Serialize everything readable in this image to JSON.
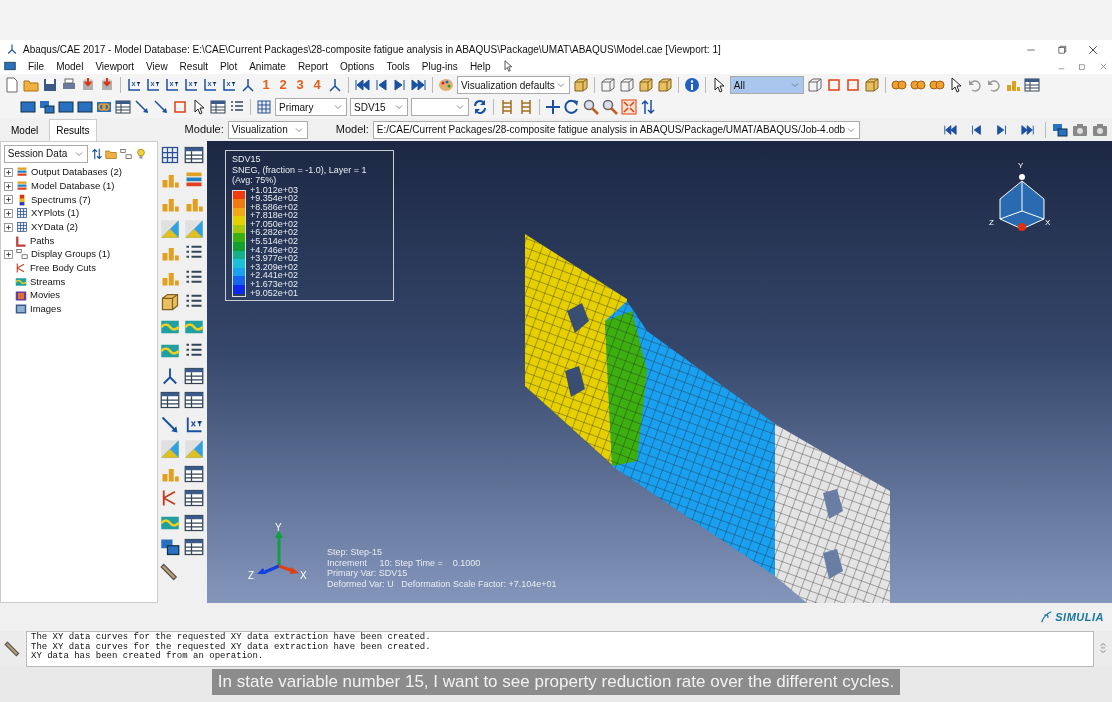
{
  "window": {
    "title": "Abaqus/CAE 2017 - Model Database: E:\\CAE\\Current Packages\\28-composite fatigue analysis in ABAQUS\\Package\\UMAT\\ABAQUS\\Model.cae [Viewport: 1]"
  },
  "menu": [
    "File",
    "Model",
    "Viewport",
    "View",
    "Result",
    "Plot",
    "Animate",
    "Report",
    "Options",
    "Tools",
    "Plug-ins",
    "Help"
  ],
  "toolbar": {
    "view_numbers": [
      "1",
      "2",
      "3",
      "4"
    ],
    "render_style": "Visualization defaults",
    "selection_filter": "All",
    "field_output_kind": "Primary",
    "field_output_variable": "SDV15"
  },
  "context": {
    "module_label": "Module:",
    "module": "Visualization",
    "model_label": "Model:",
    "model": "E:/CAE/Current Packages/28-composite fatigue analysis in ABAQUS/Package/UMAT/ABAQUS/Job-4.odb"
  },
  "tabs": [
    {
      "label": "Model",
      "selected": false
    },
    {
      "label": "Results",
      "selected": true
    }
  ],
  "session": {
    "value": "Session Data"
  },
  "tree": [
    {
      "label": "Output Databases (2)",
      "expandable": true
    },
    {
      "label": "Model Database (1)",
      "expandable": true
    },
    {
      "label": "Spectrums (7)",
      "expandable": true
    },
    {
      "label": "XYPlots (1)",
      "expandable": true
    },
    {
      "label": "XYData (2)",
      "expandable": true
    },
    {
      "label": "Paths",
      "expandable": false
    },
    {
      "label": "Display Groups (1)",
      "expandable": true
    },
    {
      "label": "Free Body Cuts",
      "expandable": false
    },
    {
      "label": "Streams",
      "expandable": false
    },
    {
      "label": "Movies",
      "expandable": false
    },
    {
      "label": "Images",
      "expandable": false
    }
  ],
  "legend": {
    "title": "SDV15",
    "subtitle": "SNEG, (fraction = -1.0), Layer = 1",
    "average": "(Avg: 75%)",
    "values": [
      "+1.012e+03",
      "+9.354e+02",
      "+8.586e+02",
      "+7.818e+02",
      "+7.050e+02",
      "+6.282e+02",
      "+5.514e+02",
      "+4.746e+02",
      "+3.977e+02",
      "+3.209e+02",
      "+2.441e+02",
      "+1.673e+02",
      "+9.052e+01"
    ],
    "bands": [
      {
        "color": "#f03a10"
      },
      {
        "color": "#f27a12"
      },
      {
        "color": "#f2a814"
      },
      {
        "color": "#e6d000"
      },
      {
        "color": "#a8c810"
      },
      {
        "color": "#3cb010"
      },
      {
        "color": "#12a030"
      },
      {
        "color": "#14b08c"
      },
      {
        "color": "#18c0d8"
      },
      {
        "color": "#1aa0f0"
      },
      {
        "color": "#1466f0"
      },
      {
        "color": "#0a28f0"
      }
    ]
  },
  "step_info": [
    "Step: Step-15",
    "Increment     10: Step Time =    0.1000",
    "Primary Var: SDV15",
    "Deformed Var: U   Deformation Scale Factor: +7.104e+01"
  ],
  "triad": {
    "y": "Y",
    "z": "Z",
    "x": "X"
  },
  "view_triad": {
    "y": "Y",
    "z": "Z",
    "x": "X"
  },
  "brand": "SIMULIA",
  "messages": [
    "The XY data curves for the requested XY data extraction have been created.",
    "The XY data curves for the requested XY data extraction have been created.",
    "XY data has been created from an operation."
  ],
  "caption": "In state variable number 15, I want to see property reduction rate over the different cycles."
}
